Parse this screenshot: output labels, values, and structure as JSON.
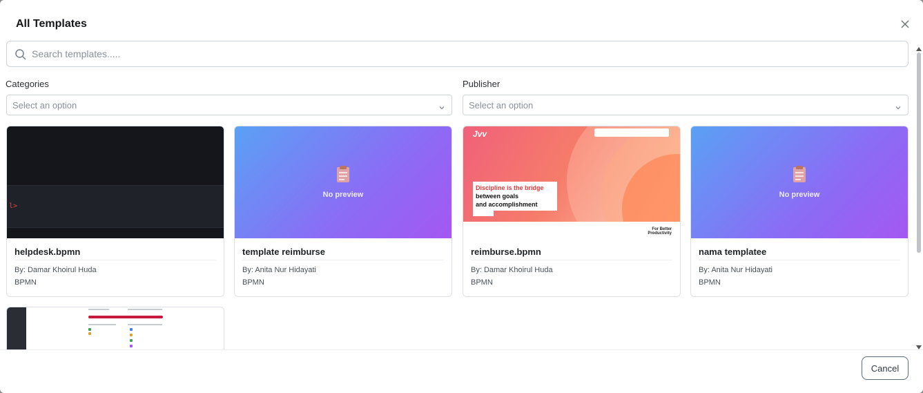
{
  "modal": {
    "title": "All Templates",
    "search": {
      "placeholder": "Search templates....."
    },
    "filters": {
      "categories": {
        "label": "Categories",
        "value": "Select an option"
      },
      "publisher": {
        "label": "Publisher",
        "value": "Select an option"
      }
    },
    "no_preview_text": "No preview",
    "templates": [
      {
        "name": "helpdesk.bpmn",
        "by": "By: Damar Khoirul Huda",
        "type": "BPMN",
        "preview": "dark-screenshot",
        "preview_text": "l>"
      },
      {
        "name": "template reimburse",
        "by": "By: Anita Nur Hidayati",
        "type": "BPMN",
        "preview": "none"
      },
      {
        "name": "reimburse.bpmn",
        "by": "By: Damar Khoirul Huda",
        "type": "BPMN",
        "preview": "image",
        "preview_text": {
          "quote_line1": "Discipline is the bridge",
          "quote_line2": "between goals",
          "quote_line3": "and accomplishment",
          "tagline_1": "For Better",
          "tagline_2": "Productivity"
        }
      },
      {
        "name": "nama templatee",
        "by": "By: Anita Nur Hidayati",
        "type": "BPMN",
        "preview": "none"
      }
    ],
    "footer": {
      "cancel_label": "Cancel"
    }
  },
  "colors": {
    "accent_red": "#c6193c",
    "card_border": "#dde0e4",
    "gradient_start": "#5aa1f5",
    "gradient_end": "#a457f2"
  },
  "icons": [
    "search-icon",
    "close-icon",
    "chevron-down-icon",
    "clipboard-icon",
    "scroll-up-icon",
    "scroll-down-icon"
  ]
}
